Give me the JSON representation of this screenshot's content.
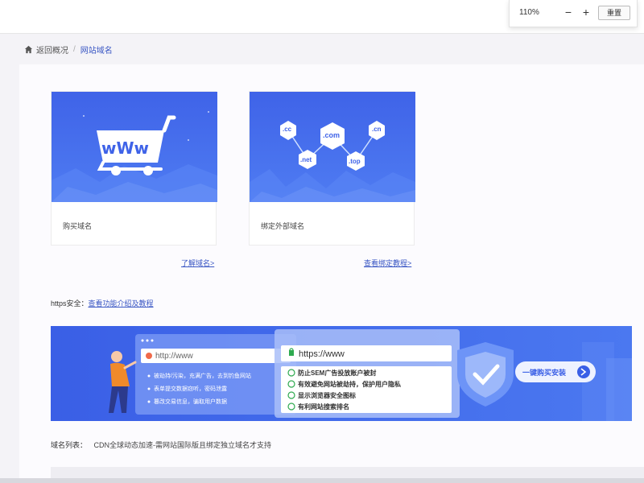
{
  "zoom": {
    "level": "110%",
    "minus": "−",
    "plus": "+",
    "reset": "重置"
  },
  "breadcrumb": {
    "back": "返回概况",
    "separator": "/",
    "current": "网站域名"
  },
  "cards": [
    {
      "label": "购买域名",
      "image_text": "wWw"
    },
    {
      "label": "绑定外部域名",
      "tlds": [
        ".cc",
        ".com",
        ".cn",
        ".net",
        ".top"
      ]
    }
  ],
  "links": {
    "learn": "了解域名>",
    "tutorial": "查看绑定教程>"
  },
  "https_section": {
    "label": "https安全：",
    "link": "查看功能介绍及教程"
  },
  "banner": {
    "http_url": "http://www",
    "https_url": "https://www",
    "risks": [
      "被劫持/污染，充满广告，去到钓鱼网站",
      "表单提交数据窃听，密码泄露",
      "篡改交易信息，骗取用户数据"
    ],
    "benefits": [
      "防止SEM广告投放账户被封",
      "有效避免网站被劫持，保护用户隐私",
      "显示浏览器安全图标",
      "有利网站搜索排名"
    ],
    "cta": "一键购买安装"
  },
  "domain_list": {
    "label": "域名列表：",
    "note": "CDN全球动态加速-需网站国际版且绑定独立域名才支持"
  },
  "colors": {
    "primary": "#3a57c4",
    "banner_blue": "#3f63e8"
  }
}
